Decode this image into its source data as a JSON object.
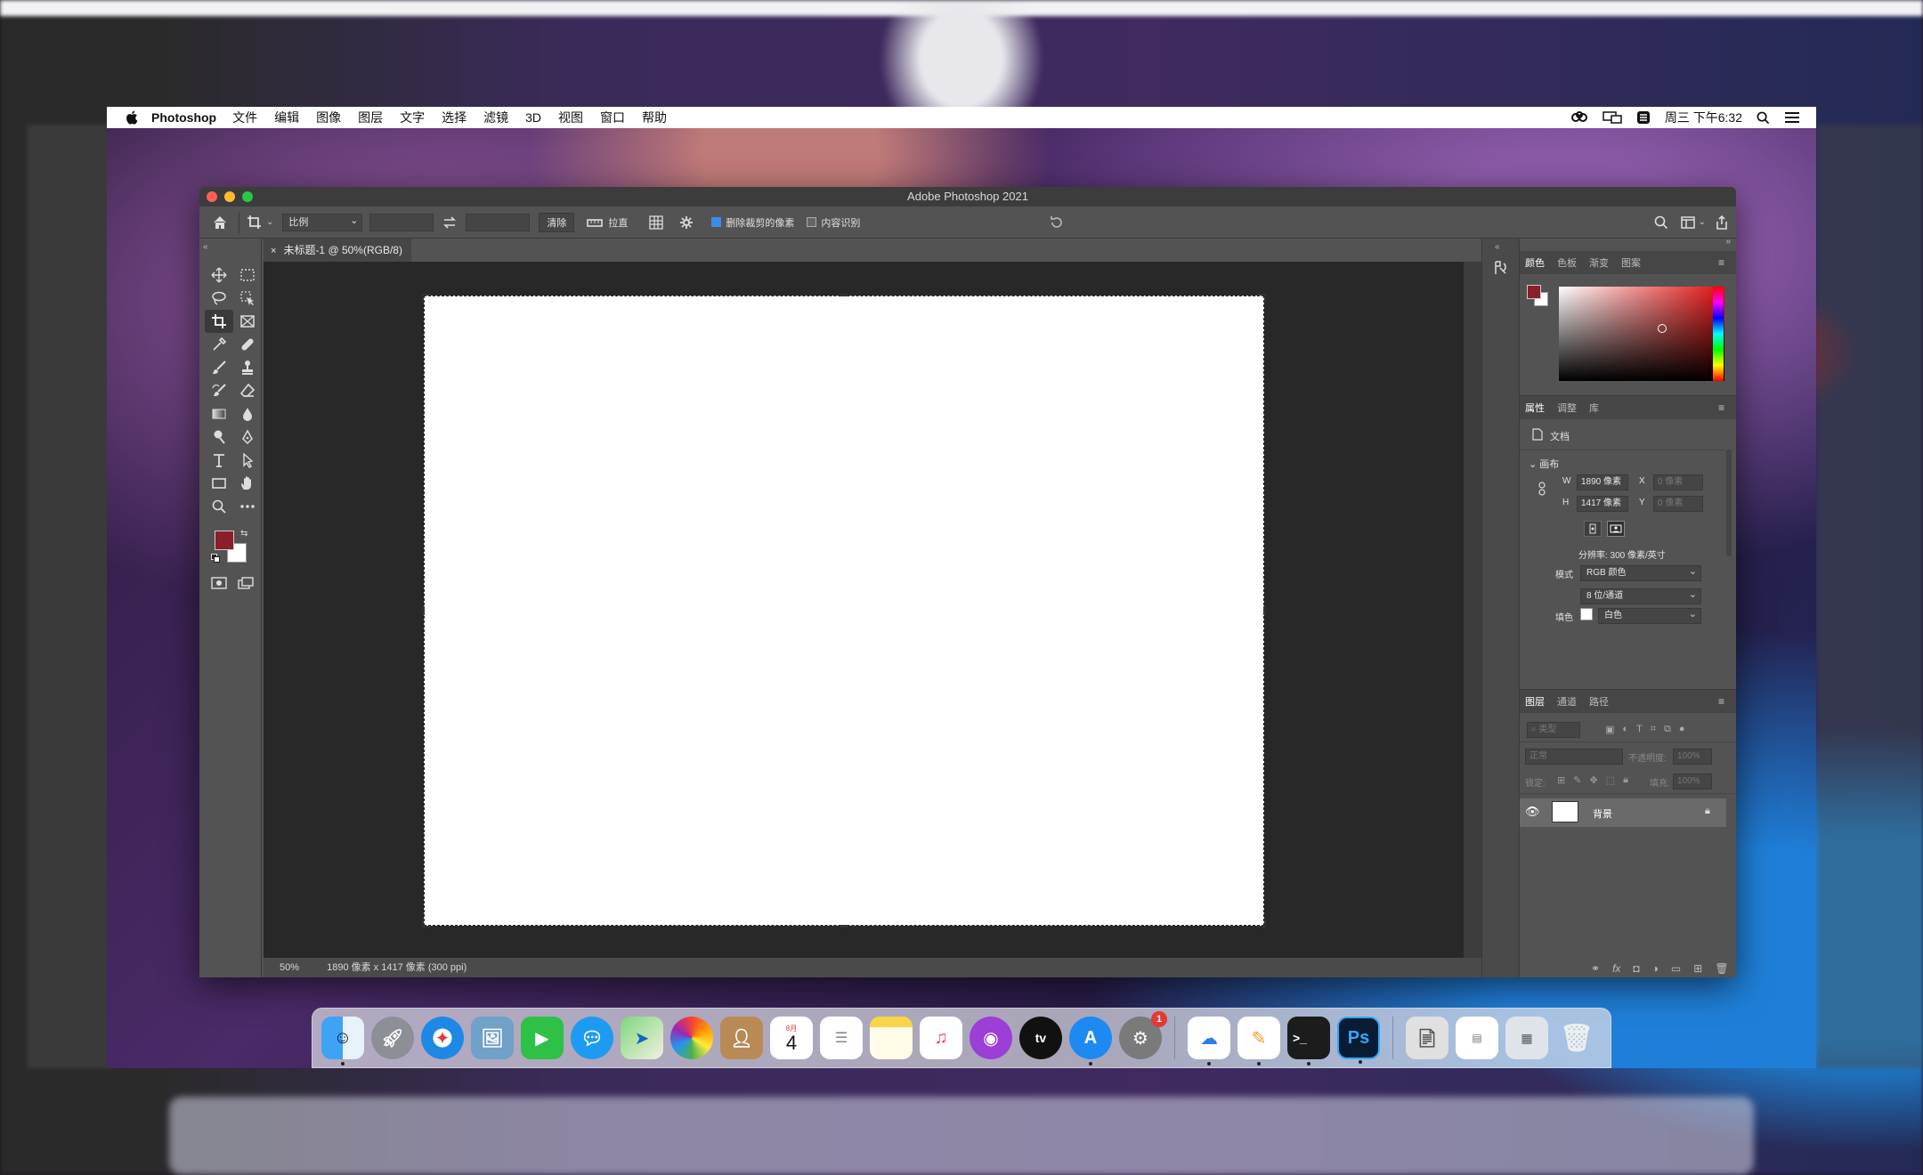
{
  "menubar": {
    "app_name": "Photoshop",
    "items": [
      "文件",
      "编辑",
      "图像",
      "图层",
      "文字",
      "选择",
      "滤镜",
      "3D",
      "视图",
      "窗口",
      "帮助"
    ],
    "clock": "周三 下午6:32"
  },
  "window": {
    "title": "Adobe Photoshop 2021"
  },
  "options_bar": {
    "ratio_select": "比例",
    "clear_button": "清除",
    "straighten_label": "拉直",
    "delete_cropped_label": "删除裁剪的像素",
    "content_aware_label": "内容识别"
  },
  "document": {
    "tab_title": "未标题-1 @ 50%(RGB/8)",
    "status_zoom": "50%",
    "status_info": "1890 像素 x 1417 像素 (300 ppi)"
  },
  "colors": {
    "foreground": "#8b1e2b",
    "background": "#ffffff"
  },
  "color_panel": {
    "tabs": [
      "颜色",
      "色板",
      "渐变",
      "图案"
    ]
  },
  "properties_panel": {
    "tabs": [
      "属性",
      "调整",
      "库"
    ],
    "doc_label": "文档",
    "section_canvas": "画布",
    "w_label": "W",
    "h_label": "H",
    "x_label": "X",
    "y_label": "Y",
    "width_value": "1890 像素",
    "height_value": "1417 像素",
    "x_placeholder": "0 像素",
    "y_placeholder": "0 像素",
    "resolution": "分辨率: 300 像素/英寸",
    "mode_label": "模式",
    "mode_value": "RGB 颜色",
    "depth_value": "8 位/通道",
    "fill_label": "填色",
    "fill_value": "白色"
  },
  "layers_panel": {
    "tabs": [
      "图层",
      "通道",
      "路径"
    ],
    "filter_placeholder": "类型",
    "blend_mode": "正常",
    "opacity_label": "不透明度:",
    "opacity_value": "100%",
    "lock_label": "锁定:",
    "fill_label": "填充:",
    "fill_value": "100%",
    "layer_name": "背景"
  },
  "dock": {
    "calendar_month": "8月",
    "calendar_day": "4",
    "notification_badge": "1",
    "ps_label": "Ps",
    "terminal_label": ">_"
  }
}
